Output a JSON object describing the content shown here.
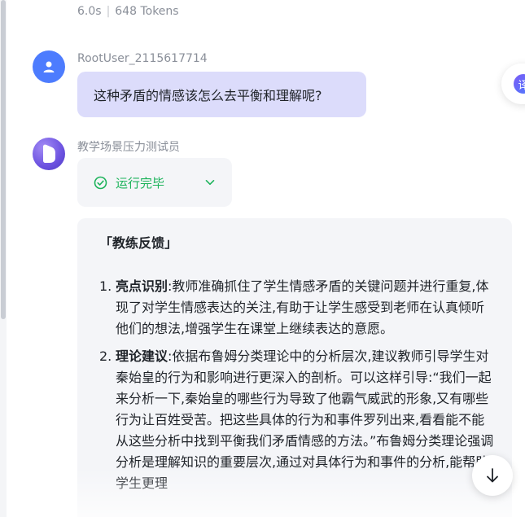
{
  "previous_message": {
    "duration": "6.0s",
    "separator": "|",
    "tokens": "648 Tokens"
  },
  "user_message": {
    "username": "RootUser_2115617714",
    "text": "这种矛盾的情感该怎么去平衡和理解呢?"
  },
  "bot_message": {
    "name": "教学场景压力测试员",
    "status_label": "运行完毕",
    "title": "「教练反馈」",
    "items": [
      {
        "number": "1.",
        "heading": "亮点识别",
        "text": ":教师准确抓住了学生情感矛盾的关键问题并进行重复,体现了对学生情感表达的关注,有助于让学生感受到老师在认真倾听他们的想法,增强学生在课堂上继续表达的意愿。"
      },
      {
        "number": "2.",
        "heading": "理论建议",
        "text": ":依据布鲁姆分类理论中的分析层次,建议教师引导学生对秦始皇的行为和影响进行更深入的剖析。可以这样引导:“我们一起来分析一下,秦始皇的哪些行为导致了他霸气威武的形象,又有哪些行为让百姓受苦。把这些具体的行为和事件罗列出来,看看能不能从这些分析中找到平衡我们矛盾情感的方法。”布鲁姆分类理论强调分析是理解知识的重要层次,通过对具体行为和事件的分析,能帮助学生更理"
      }
    ]
  },
  "floating_button": {
    "glyph": "译"
  },
  "colors": {
    "user_bubble": "#dcdcfb",
    "user_avatar": "#4d7cfe",
    "status_green": "#1db35b",
    "card_bg": "#f4f5f8"
  },
  "icons": {
    "user_avatar": "person-icon",
    "bot_avatar": "bot-logo-icon",
    "status": "check-circle-icon",
    "expand": "chevron-down-icon",
    "scroll": "arrow-down-icon"
  }
}
